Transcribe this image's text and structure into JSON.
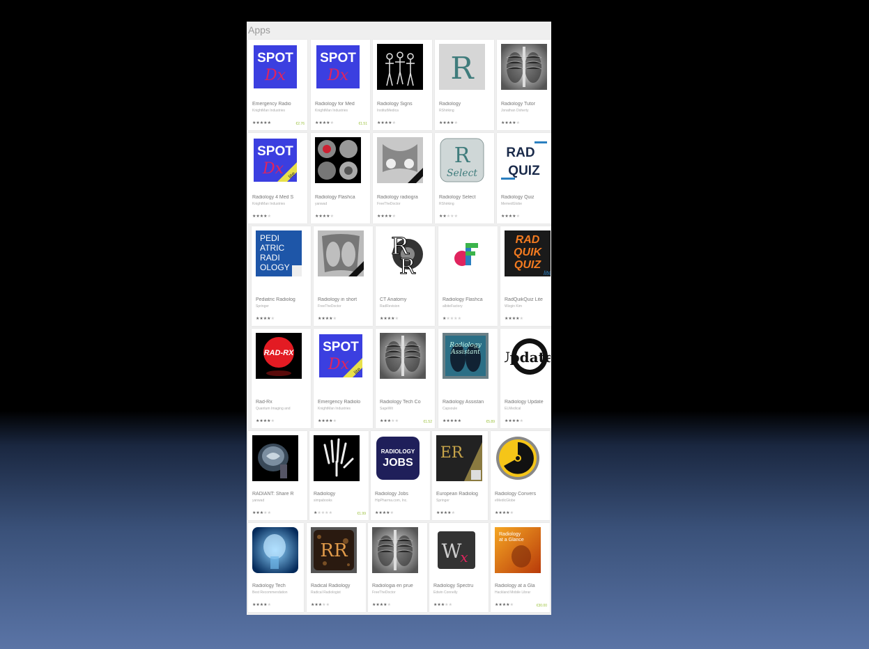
{
  "section_title": "Apps",
  "colors": {
    "price": "#9ac13a",
    "card_bg": "#ffffff",
    "panel_bg": "#efefef"
  },
  "apps": [
    {
      "title": "Emergency Radio",
      "developer": "KnightMan Industries",
      "rating": 5,
      "price": "€2.76",
      "icon": "spot-dx-icon"
    },
    {
      "title": "Radiology for Med",
      "developer": "KnightMan Industries",
      "rating": 4,
      "price": "€1.51",
      "icon": "spot-dx-icon"
    },
    {
      "title": "Radiology Signs",
      "developer": "InstitutMedica",
      "rating": 4,
      "price": "",
      "icon": "skeleton-icon"
    },
    {
      "title": "Radiology",
      "developer": "RShirking",
      "rating": 4,
      "price": "",
      "icon": "letter-r-icon"
    },
    {
      "title": "Radiology Tutor",
      "developer": "Jonathan Doherty",
      "rating": 4,
      "price": "",
      "icon": "chest-xray-icon"
    },
    {
      "title": "Radiology 4 Med S",
      "developer": "KnightMan Industries",
      "rating": 4,
      "price": "",
      "icon": "spot-dx-lite-icon"
    },
    {
      "title": "Radiology Flashca",
      "developer": "yanwad",
      "rating": 4,
      "price": "",
      "icon": "ct-scan-icon"
    },
    {
      "title": "Radiology radiogra",
      "developer": "FreeTheDoctor",
      "rating": 4,
      "price": "",
      "icon": "pelvis-xray-icon"
    },
    {
      "title": "Radiology Select",
      "developer": "RShirking",
      "rating": 2,
      "price": "",
      "icon": "r-select-icon"
    },
    {
      "title": "Radiology Quiz",
      "developer": "MemedGlobe",
      "rating": 4,
      "price": "",
      "icon": "rad-quiz-icon"
    },
    {
      "title": "Pediatric Radiolog",
      "developer": "Springer",
      "rating": 4,
      "price": "",
      "icon": "pediatric-radiology-icon"
    },
    {
      "title": "Radiology in short",
      "developer": "FreeTheDoctor",
      "rating": 4,
      "price": "",
      "icon": "xray-usa-icon"
    },
    {
      "title": "CT Anatomy",
      "developer": "RadRevision",
      "rating": 4,
      "price": "",
      "icon": "ct-anatomy-icon"
    },
    {
      "title": "Radiology Flashca",
      "developer": "albiteFactory",
      "rating": 1,
      "price": "",
      "icon": "flashcard-logo-icon"
    },
    {
      "title": "RadQuikQuiz Lite",
      "developer": "Wizgin Kim",
      "rating": 4,
      "price": "",
      "icon": "rad-quik-quiz-icon"
    },
    {
      "title": "Rad-Rx",
      "developer": "Quantum Imaging and",
      "rating": 4,
      "price": "",
      "icon": "rad-rx-icon"
    },
    {
      "title": "Emergency Radiolo",
      "developer": "KnightMan Industries",
      "rating": 4,
      "price": "",
      "icon": "spot-dx-lite-icon"
    },
    {
      "title": "Radiology Tech Co",
      "developer": "SageWit",
      "rating": 3,
      "price": "€1.52",
      "icon": "chest-xray-icon"
    },
    {
      "title": "Radiology Assistan",
      "developer": "Capsoule",
      "rating": 5,
      "price": "€5.89",
      "icon": "radiology-assistant-icon"
    },
    {
      "title": "Radiology Update",
      "developer": "ELMedical",
      "rating": 4,
      "price": "",
      "icon": "updates-icon"
    },
    {
      "title": "RADIANT: Share R",
      "developer": "yanwad",
      "rating": 3,
      "price": "",
      "icon": "brain-mri-icon"
    },
    {
      "title": "Radiology",
      "developer": "simpabooks",
      "rating": 1,
      "price": "€1.99",
      "icon": "hand-xray-icon"
    },
    {
      "title": "Radiology Jobs",
      "developer": "HipPharma.com, Inc.",
      "rating": 4,
      "price": "",
      "icon": "radiology-jobs-icon"
    },
    {
      "title": "European Radiolog",
      "developer": "Springer",
      "rating": 4,
      "price": "",
      "icon": "european-radiology-icon"
    },
    {
      "title": "Radiology Convers",
      "developer": "eMedicGlobe",
      "rating": 4,
      "price": "",
      "icon": "radiation-hazard-icon"
    },
    {
      "title": "Radiology Tech",
      "developer": "Best Recommendation",
      "rating": 4,
      "price": "",
      "icon": "head-scan-icon"
    },
    {
      "title": "Radical Radiology",
      "developer": "Radical Radiologist",
      "rating": 3,
      "price": "",
      "icon": "radical-radiology-icon"
    },
    {
      "title": "Radiologia en prue",
      "developer": "FreeTheDoctor",
      "rating": 4,
      "price": "",
      "icon": "chest-xray-icon"
    },
    {
      "title": "Radiology Spectru",
      "developer": "Edwin Connelly",
      "rating": 3,
      "price": "",
      "icon": "spectrum-wx-icon"
    },
    {
      "title": "Radiology at a Gla",
      "developer": "Hackland Mobile Librar",
      "rating": 4,
      "price": "€30.00",
      "icon": "at-a-glance-icon"
    }
  ]
}
